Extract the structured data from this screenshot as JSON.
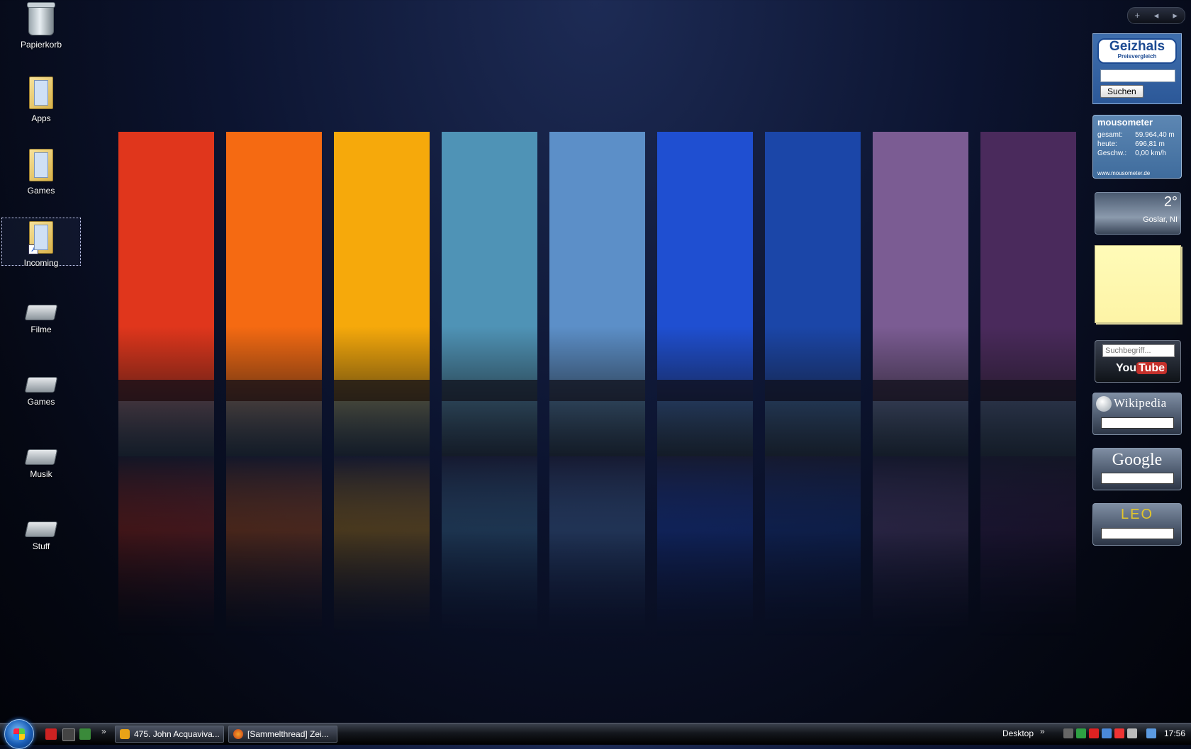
{
  "desktop_icons": [
    {
      "label": "Papierkorb",
      "icon": "recycle-bin-icon"
    },
    {
      "label": "Apps",
      "icon": "folder-icon"
    },
    {
      "label": "Games",
      "icon": "folder-icon"
    },
    {
      "label": "Incoming",
      "icon": "folder-shortcut-icon"
    },
    {
      "label": "Filme",
      "icon": "drive-shortcut-icon"
    },
    {
      "label": "Games",
      "icon": "drive-shortcut-icon"
    },
    {
      "label": "Musik",
      "icon": "drive-shortcut-icon"
    },
    {
      "label": "Stuff",
      "icon": "drive-shortcut-icon"
    }
  ],
  "wallpaper": {
    "strips": [
      "#e0361c",
      "#f56a12",
      "#f6a90b",
      "#4f93b6",
      "#5c8fc8",
      "#1f4fd1",
      "#1b46a8",
      "#7b5c93",
      "#4a2a5c"
    ]
  },
  "sidebar": {
    "controls": {
      "add": "+",
      "prev": "◂",
      "next": "▸"
    },
    "geizhals": {
      "logo": "Geizhals",
      "logo_sub": "Preisvergleich",
      "search_button": "Suchen"
    },
    "mousometer": {
      "title": "mousometer",
      "rows": [
        {
          "label": "gesamt:",
          "value": "59.964,40 m"
        },
        {
          "label": "heute:",
          "value": "696,81 m"
        },
        {
          "label": "Geschw.:",
          "value": "0,00 km/h"
        }
      ],
      "url": "www.mousometer.de"
    },
    "weather": {
      "temperature": "2°",
      "location": "Goslar, NI"
    },
    "youtube": {
      "placeholder": "Suchbegriff...",
      "logo_you": "You",
      "logo_tube": "Tube"
    },
    "wikipedia": {
      "logo": "Wikipedia"
    },
    "google": {
      "logo": "Google"
    },
    "leo": {
      "logo": "LEO"
    }
  },
  "taskbar": {
    "tasks": [
      {
        "label": "475. John Acquaviva..."
      },
      {
        "label": "[Sammelthread] Zei..."
      }
    ],
    "desktop_toolbar": "Desktop",
    "clock": "17:56",
    "chevron": "»"
  }
}
